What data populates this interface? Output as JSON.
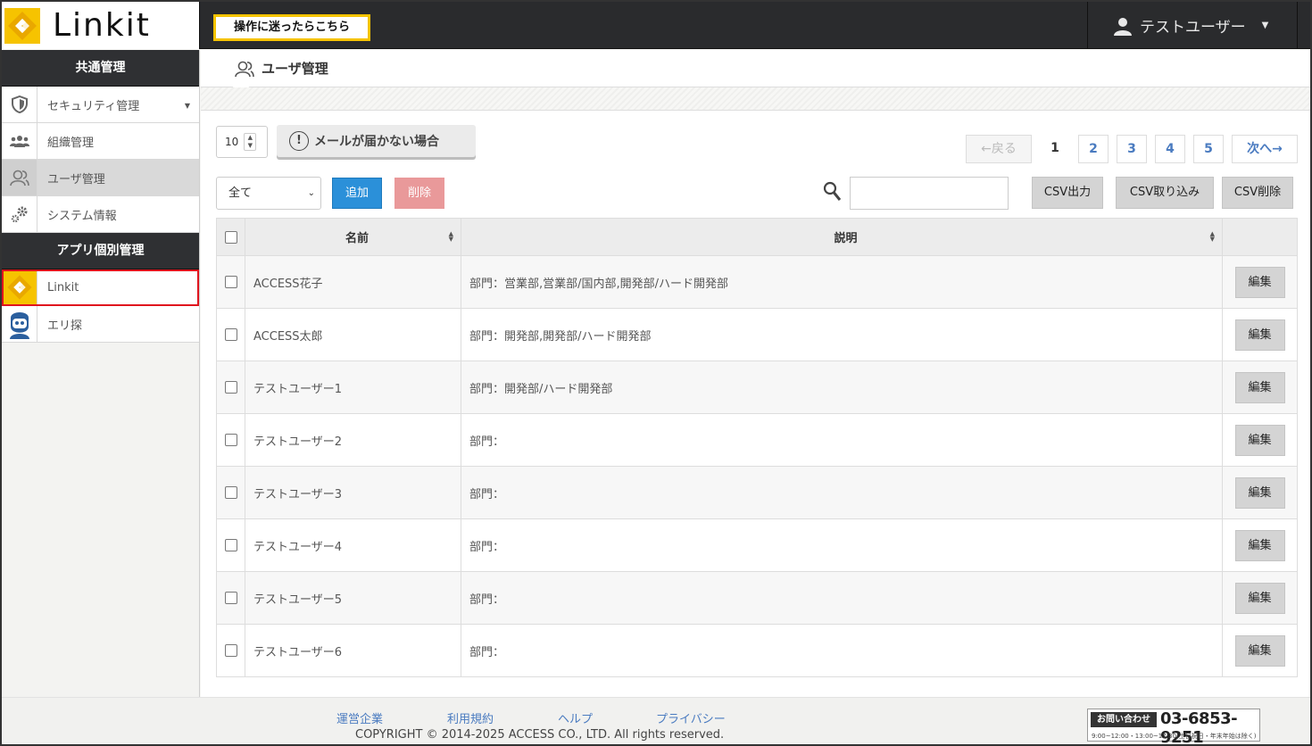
{
  "app": {
    "logo_text": "Linkit"
  },
  "header": {
    "help_button": "操作に迷ったらこちら",
    "user_name": "テストユーザー"
  },
  "sidebar": {
    "section1": "共通管理",
    "items1": [
      {
        "label": "セキュリティ管理"
      },
      {
        "label": "組織管理"
      },
      {
        "label": "ユーザ管理"
      },
      {
        "label": "システム情報"
      }
    ],
    "section2": "アプリ個別管理",
    "items2": [
      {
        "label": "Linkit"
      },
      {
        "label": "エリ探"
      }
    ]
  },
  "page": {
    "title": "ユーザ管理"
  },
  "toolbar": {
    "per_page": "10",
    "no_mail_button": "メールが届かない場合",
    "filter_value": "全て",
    "add_button": "追加",
    "delete_button": "削除",
    "search_value": "",
    "csv_export": "CSV出力",
    "csv_import": "CSV取り込み",
    "csv_delete": "CSV削除"
  },
  "pagination": {
    "prev": "←戻る",
    "current": "1",
    "pages": [
      "2",
      "3",
      "4",
      "5"
    ],
    "next": "次へ→"
  },
  "table": {
    "headers": {
      "name": "名前",
      "description": "説明"
    },
    "rows": [
      {
        "name": "ACCESS花子",
        "description": "部門：営業部,営業部/国内部,開発部/ハード開発部",
        "action": "編集"
      },
      {
        "name": "ACCESS太郎",
        "description": "部門：開発部,開発部/ハード開発部",
        "action": "編集"
      },
      {
        "name": "テストユーザー1",
        "description": "部門：開発部/ハード開発部",
        "action": "編集"
      },
      {
        "name": "テストユーザー2",
        "description": "部門：",
        "action": "編集"
      },
      {
        "name": "テストユーザー3",
        "description": "部門：",
        "action": "編集"
      },
      {
        "name": "テストユーザー4",
        "description": "部門：",
        "action": "編集"
      },
      {
        "name": "テストユーザー5",
        "description": "部門：",
        "action": "編集"
      },
      {
        "name": "テストユーザー6",
        "description": "部門：",
        "action": "編集"
      }
    ]
  },
  "footer": {
    "links": [
      "運営企業",
      "利用規約",
      "ヘルプ",
      "プライバシー"
    ],
    "copyright": "COPYRIGHT © 2014-2025 ACCESS CO., LTD. All rights reserved.",
    "contact_label": "お問い合わせ",
    "phone": "03-6853-9251",
    "hours": "9:00~12:00・13:00~17:30(土日祝日・年末年始は除く)"
  },
  "colors": {
    "accent_yellow": "#f6c300",
    "add_blue": "#2b90d9",
    "delete_pink": "#e9999a",
    "selected_outline": "#e0141e",
    "link_blue": "#4a7bc0"
  }
}
